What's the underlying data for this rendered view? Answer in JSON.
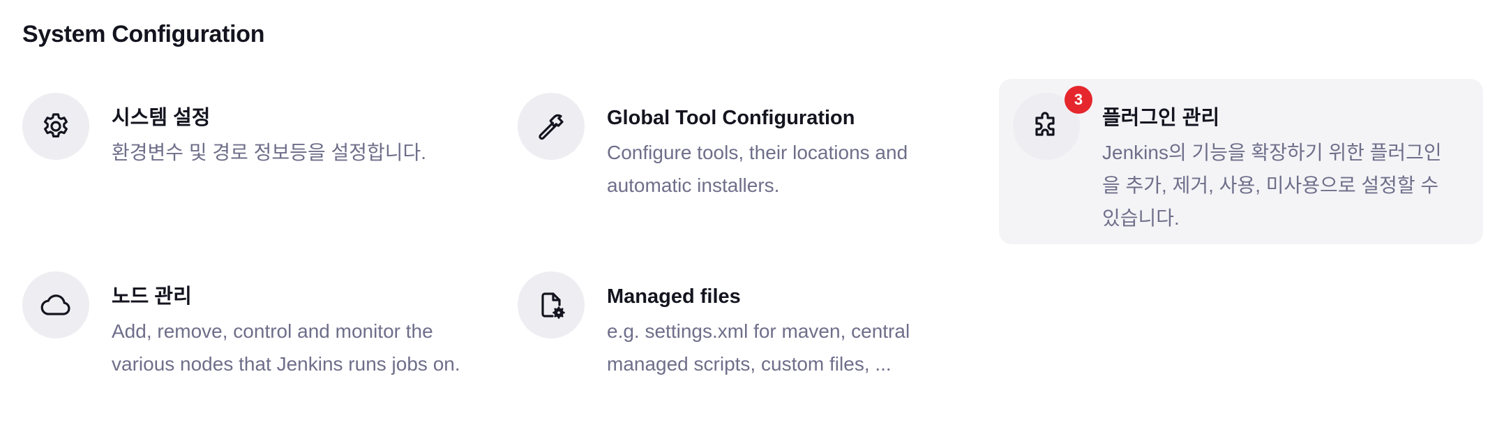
{
  "section": {
    "title": "System Configuration"
  },
  "tiles": [
    {
      "icon": "gear-icon",
      "title": "시스템 설정",
      "description": "환경변수 및 경로 정보등을 설정합니다."
    },
    {
      "icon": "hammer-icon",
      "title": "Global Tool Configuration",
      "description": "Configure tools, their locations and automatic installers."
    },
    {
      "icon": "puzzle-icon",
      "title": "플러그인 관리",
      "description": "Jenkins의 기능을 확장하기 위한 플러그인을 추가, 제거, 사용, 미사용으로 설정할 수 있습니다.",
      "badge": "3"
    },
    {
      "icon": "cloud-icon",
      "title": "노드 관리",
      "description": "Add, remove, control and monitor the various nodes that Jenkins runs jobs on."
    },
    {
      "icon": "file-gear-icon",
      "title": "Managed files",
      "description": "e.g. settings.xml for maven, central managed scripts, custom files, ..."
    }
  ],
  "colors": {
    "badge": "#e5262d",
    "hover_background": "#f4f4f7",
    "icon_background": "#eeeef2",
    "description_text": "#6e6e8a"
  }
}
